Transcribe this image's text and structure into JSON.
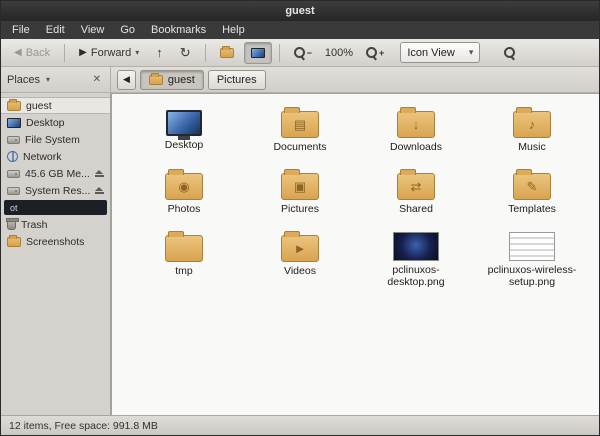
{
  "window": {
    "title": "guest"
  },
  "menubar": {
    "items": [
      "File",
      "Edit",
      "View",
      "Go",
      "Bookmarks",
      "Help"
    ]
  },
  "toolbar": {
    "back_label": "Back",
    "forward_label": "Forward",
    "zoom_level": "100%",
    "view_mode": "Icon View"
  },
  "pathbar": {
    "nav_back": "◀",
    "buttons": [
      {
        "label": "guest",
        "active": true
      },
      {
        "label": "Pictures",
        "active": false
      }
    ]
  },
  "sidebar": {
    "title": "Places",
    "items": [
      {
        "label": "guest"
      },
      {
        "label": "Desktop"
      },
      {
        "label": "File System"
      },
      {
        "label": "Network"
      },
      {
        "label": "45.6 GB Me..."
      },
      {
        "label": "System Res..."
      },
      {
        "label": "ot"
      },
      {
        "label": "Trash"
      },
      {
        "label": "Screenshots"
      }
    ]
  },
  "files": [
    {
      "label": "Desktop",
      "emblem": ""
    },
    {
      "label": "Documents",
      "emblem": "▤"
    },
    {
      "label": "Downloads",
      "emblem": "↓"
    },
    {
      "label": "Music",
      "emblem": "♪"
    },
    {
      "label": "Photos",
      "emblem": "◉"
    },
    {
      "label": "Pictures",
      "emblem": "▣"
    },
    {
      "label": "Shared",
      "emblem": "⇄"
    },
    {
      "label": "Templates",
      "emblem": "✎"
    },
    {
      "label": "tmp",
      "emblem": ""
    },
    {
      "label": "Videos",
      "emblem": "►"
    },
    {
      "label": "pclinuxos-desktop.png",
      "emblem": ""
    },
    {
      "label": "pclinuxos-wireless-setup.png",
      "emblem": ""
    }
  ],
  "statusbar": {
    "text": "12 items, Free space: 991.8 MB"
  }
}
